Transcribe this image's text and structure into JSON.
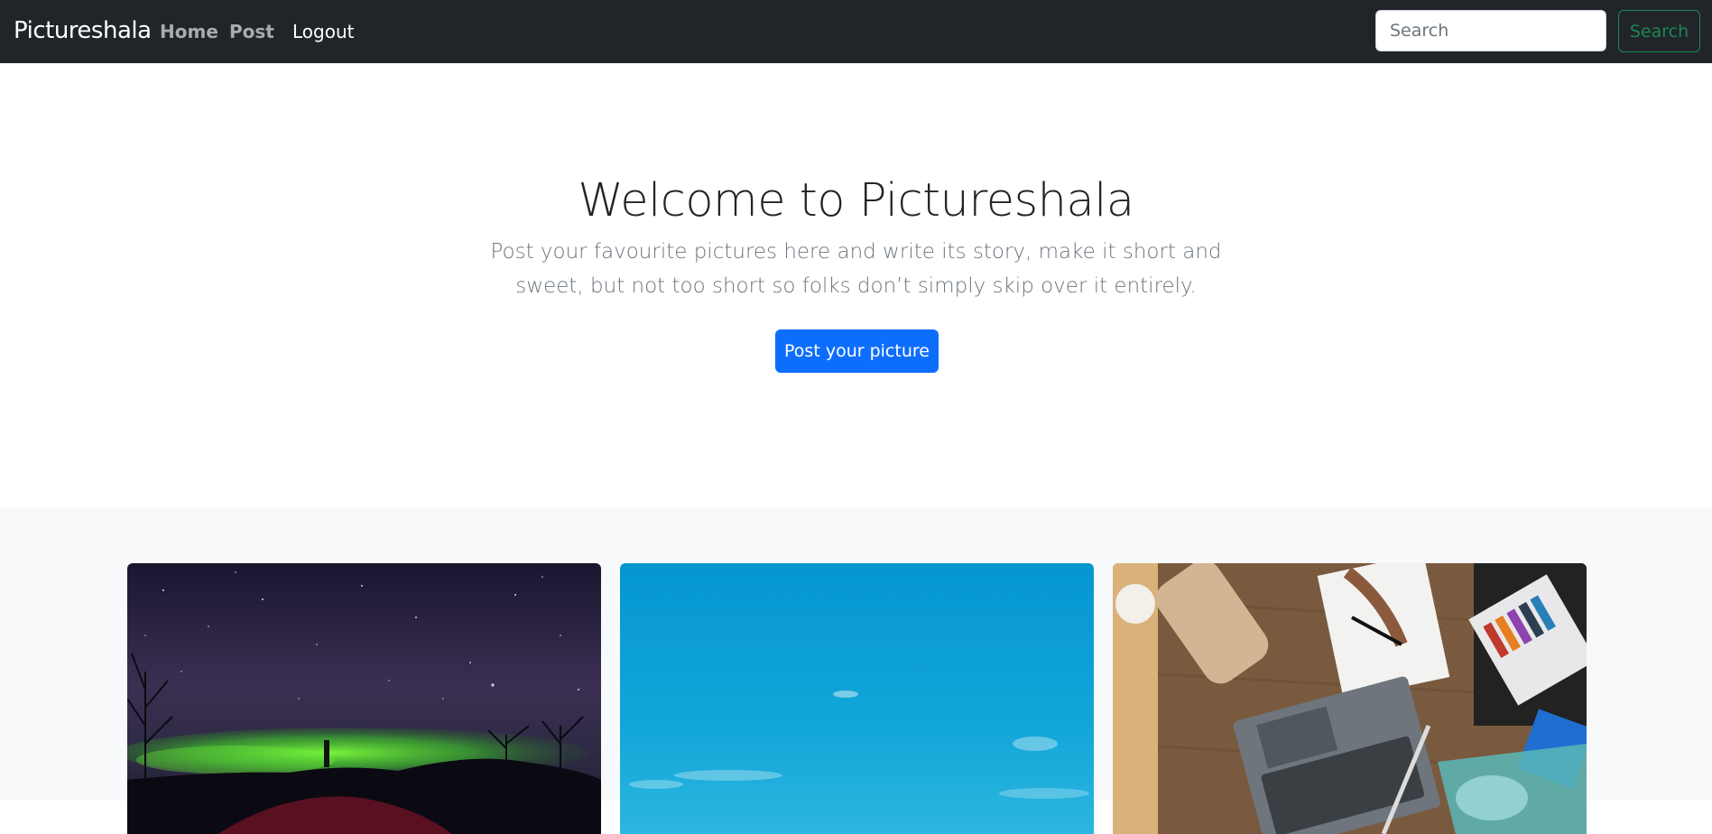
{
  "navbar": {
    "brand": "Pictureshala",
    "links": [
      {
        "label": "Home"
      },
      {
        "label": "Post"
      },
      {
        "label": "Logout"
      }
    ],
    "search": {
      "placeholder": "Search",
      "button_label": "Search"
    }
  },
  "hero": {
    "title": "Welcome to Pictureshala",
    "lead": "Post your favourite pictures here and write its story, make it short and sweet, but not too short so folks don’t simply skip over it entirely.",
    "button_label": "Post your picture"
  },
  "colors": {
    "navbar_bg": "#212529",
    "primary": "#0d6efd",
    "success": "#198754",
    "album_bg": "#f8f9fa"
  },
  "album": {
    "cards": [
      {
        "image": "aurora-night-sky"
      },
      {
        "image": "blue-sky"
      },
      {
        "image": "desk-workspace-laptop"
      }
    ]
  }
}
